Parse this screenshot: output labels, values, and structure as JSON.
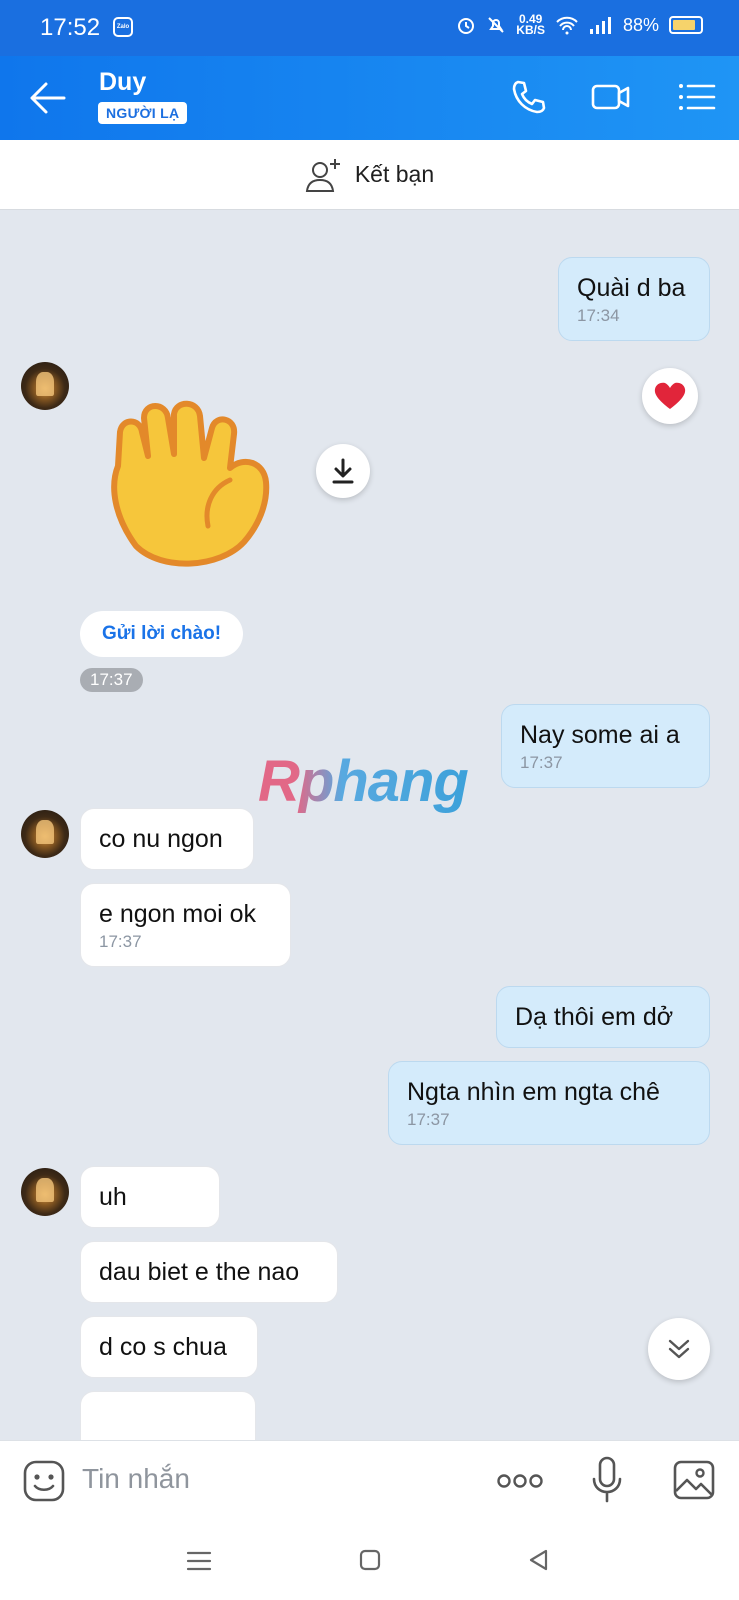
{
  "status_bar": {
    "time": "17:52",
    "app_badge": "Zalo",
    "network_speed": "0.49",
    "network_unit": "KB/S",
    "battery": "88%",
    "battery_level": 0.88
  },
  "header": {
    "contact_name": "Duy",
    "badge": "NGƯỜI LẠ"
  },
  "friend_bar": {
    "label": "Kết bạn"
  },
  "messages": {
    "m1": {
      "text": "Quài d ba",
      "time": "17:34"
    },
    "wave_greeting": {
      "button": "Gửi lời chào!",
      "time": "17:37",
      "reaction": "heart"
    },
    "m2": {
      "text": "Nay some ai a",
      "time": "17:37"
    },
    "m3": {
      "text": "co nu ngon"
    },
    "m4": {
      "text": "e ngon moi ok",
      "time": "17:37"
    },
    "m5": {
      "text": "Dạ thôi em dở"
    },
    "m6": {
      "text": "Ngta nhìn em ngta chê",
      "time": "17:37"
    },
    "m7": {
      "text": "uh"
    },
    "m8": {
      "text": "dau biet e the nao"
    },
    "m9": {
      "text": "d co s chua"
    }
  },
  "watermark": "Rphang",
  "input": {
    "placeholder": "Tin nhắn"
  },
  "colors": {
    "header": "#1a7ff0",
    "my_bubble": "#d4ebfb",
    "their_bubble": "#ffffff",
    "chat_bg": "#e2e7ee"
  }
}
